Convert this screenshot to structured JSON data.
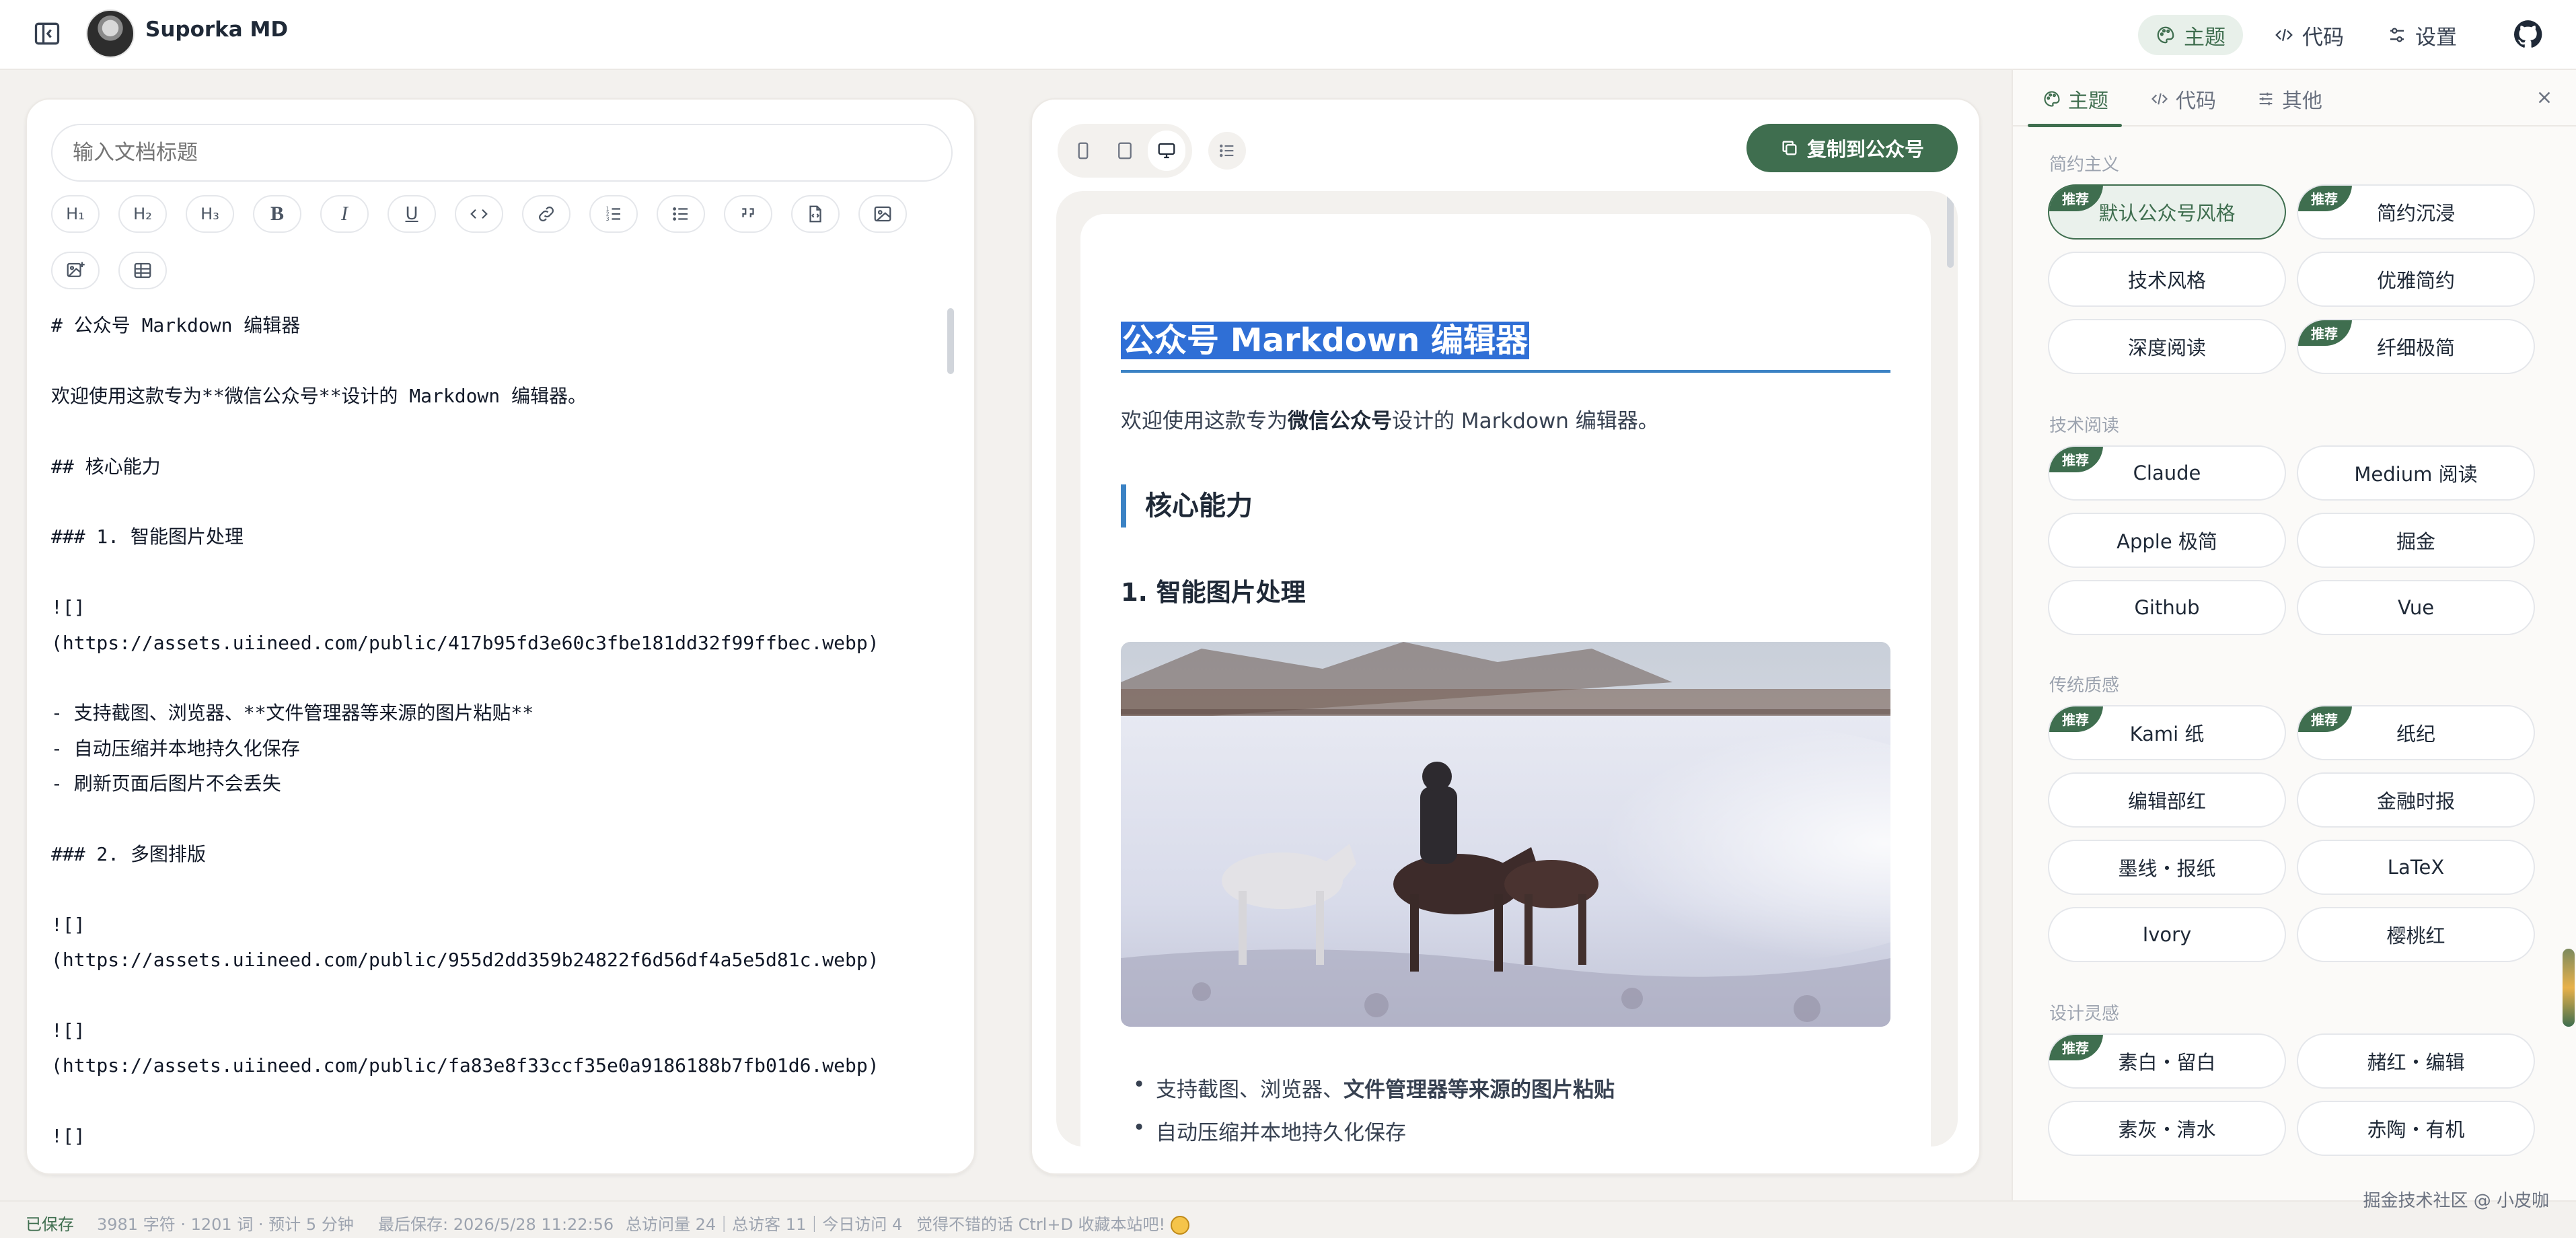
{
  "app": {
    "title": "Suporka MD"
  },
  "topbar": {
    "theme_label": "主题",
    "code_label": "代码",
    "settings_label": "设置"
  },
  "editor": {
    "title_placeholder": "输入文档标题",
    "toolbar": [
      "H₁",
      "H₂",
      "H₃",
      "B",
      "I",
      "U",
      "code",
      "link",
      "ol",
      "ul",
      "quote",
      "file",
      "image",
      "image-gallery",
      "table"
    ],
    "lines": [
      "# 公众号 Markdown 编辑器",
      "",
      "欢迎使用这款专为**微信公众号**设计的 Markdown 编辑器。",
      "",
      "## 核心能力",
      "",
      "### 1. 智能图片处理",
      "",
      "![]",
      "(https://assets.uiineed.com/public/417b95fd3e60c3fbe181dd32f99ffbec.webp)",
      "",
      "- 支持截图、浏览器、**文件管理器等来源的图片粘贴**",
      "- 自动压缩并本地持久化保存",
      "- 刷新页面后图片不会丢失",
      "",
      "### 2. 多图排版",
      "",
      "![]",
      "(https://assets.uiineed.com/public/955d2dd359b24822f6d56df4a5e5d81c.webp)",
      "",
      "![]",
      "(https://assets.uiineed.com/public/fa83e8f33ccf35e0a9186188b7fb01d6.webp)",
      "",
      "![]"
    ]
  },
  "preview": {
    "copy_button": "复制到公众号",
    "h1": "公众号 Markdown 编辑器",
    "p_before": "欢迎使用这款专为",
    "p_bold": "微信公众号",
    "p_after": "设计的 Markdown 编辑器。",
    "h2": "核心能力",
    "h3": "1. 智能图片处理",
    "li1_before": "支持截图、浏览器、",
    "li1_bold": "文件管理器等来源的图片粘贴",
    "li2": "自动压缩并本地持久化保存"
  },
  "sidebar": {
    "tabs": [
      "主题",
      "代码",
      "其他"
    ],
    "badge": "推荐",
    "sections": [
      {
        "title": "简约主义",
        "themes": [
          {
            "name": "默认公众号风格",
            "recommended": true,
            "active": true
          },
          {
            "name": "简约沉浸",
            "recommended": true
          },
          {
            "name": "技术风格"
          },
          {
            "name": "优雅简约"
          },
          {
            "name": "深度阅读"
          },
          {
            "name": "纤细极简",
            "recommended": true
          }
        ]
      },
      {
        "title": "技术阅读",
        "themes": [
          {
            "name": "Claude",
            "recommended": true
          },
          {
            "name": "Medium 阅读"
          },
          {
            "name": "Apple 极简"
          },
          {
            "name": "掘金"
          },
          {
            "name": "Github"
          },
          {
            "name": "Vue"
          }
        ]
      },
      {
        "title": "传统质感",
        "themes": [
          {
            "name": "Kami 纸",
            "recommended": true
          },
          {
            "name": "纸纪",
            "recommended": true
          },
          {
            "name": "编辑部红"
          },
          {
            "name": "金融时报"
          },
          {
            "name": "墨线・报纸"
          },
          {
            "name": "LaTeX"
          },
          {
            "name": "Ivory"
          },
          {
            "name": "樱桃红"
          }
        ]
      },
      {
        "title": "设计灵感",
        "themes": [
          {
            "name": "素白・留白",
            "recommended": true
          },
          {
            "name": "赭红・编辑"
          },
          {
            "name": "素灰・清水"
          },
          {
            "name": "赤陶・有机"
          }
        ]
      }
    ]
  },
  "status": {
    "saved": "已保存",
    "stats": "3981 字符 · 1201 词 · 预计 5 分钟",
    "last_saved": "最后保存: 2026/5/28 11:22:56",
    "visits": "总访问量 24｜总访客 11｜今日访问 4",
    "tip": "觉得不错的话 Ctrl+D 收藏本站吧!",
    "watermark": "掘金技术社区 @ 小皮咖"
  },
  "colors": {
    "accent": "#3f6e4f",
    "heading_blue": "#3b82c4",
    "selection": "#2f6fd6"
  }
}
